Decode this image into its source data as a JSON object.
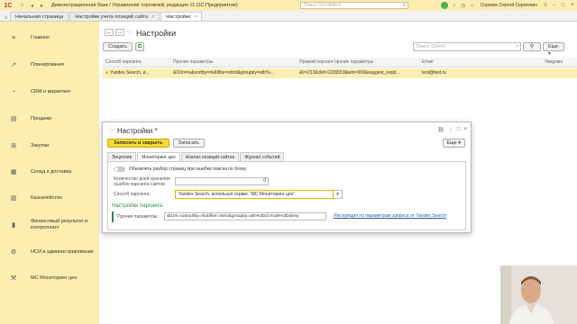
{
  "titlebar": {
    "logo": "1С",
    "title": "Демонстрационная база / Управление торговлей, редакция 11  (1С:Предприятие)",
    "search_placeholder": "Поиск Ctrl+Shift+F",
    "user": "Сорокин Сергей Сергеевич"
  },
  "tabs": [
    {
      "label": "Начальная страница"
    },
    {
      "label": "Настройки учета позиций сайта"
    },
    {
      "label": "Настройки"
    }
  ],
  "sidebar": {
    "items": [
      {
        "label": "Главное",
        "icon": "menu-icon"
      },
      {
        "label": "Планирование",
        "icon": "chart-icon"
      },
      {
        "label": "CRM и маркетинг",
        "icon": "pie-icon"
      },
      {
        "label": "Продажи",
        "icon": "bag-icon"
      },
      {
        "label": "Закупки",
        "icon": "cart-icon"
      },
      {
        "label": "Склад и доставка",
        "icon": "box-icon"
      },
      {
        "label": "Казначейство",
        "icon": "coin-icon"
      },
      {
        "label": "Финансовый результат и контроллинг",
        "icon": "graph-icon"
      },
      {
        "label": "НСИ и администрирование",
        "icon": "gear-icon"
      },
      {
        "label": "МС Мониторинг цен",
        "icon": "monitor-icon"
      }
    ]
  },
  "main": {
    "title": "Настройки",
    "create_label": "Создать",
    "search_placeholder": "Поиск (Ctrl+F)",
    "more_label": "Еще",
    "columns": [
      "Способ парсинга",
      "Прочие параметры",
      "Прямой парсинг прочие параметры",
      "Email",
      "Уведомл"
    ],
    "row": [
      "Yandex Search, и...",
      "&l10n=ru&sortby=rlv&filter=strict&groupby=attr%...",
      "&lr=213&clid=2226553&win=369&suggest_reqid...",
      "test@test.ru",
      ""
    ]
  },
  "dialog": {
    "title": "Настройки *",
    "save_close": "Записать и закрыть",
    "save": "Записать",
    "more": "Еще",
    "tabs": [
      "Лицензия",
      "Мониторинг цен",
      "Анализ позиций сайтов",
      "Журнал событий"
    ],
    "toggle_label": "Обновлять разбор страниц при ошибке поиска по блоку",
    "days_label_1": "Количество дней хранения",
    "days_label_2": "ошибок парсинга сайтов:",
    "days_value": "0",
    "method_label": "Способ парсинга",
    "method_value": "Yandex Search, используя сервис \"МС Мониторинг цен\"",
    "section_title": "Настройки парсинга",
    "params_label": "Прочие параметры:",
    "params_value": "&l10n=ru&sortby=rlv&filter=strict&groupby=attr%3Dd.mode%3Ddeep",
    "params_link": "Инструкция по параметрам запроса от Yandex Search"
  }
}
